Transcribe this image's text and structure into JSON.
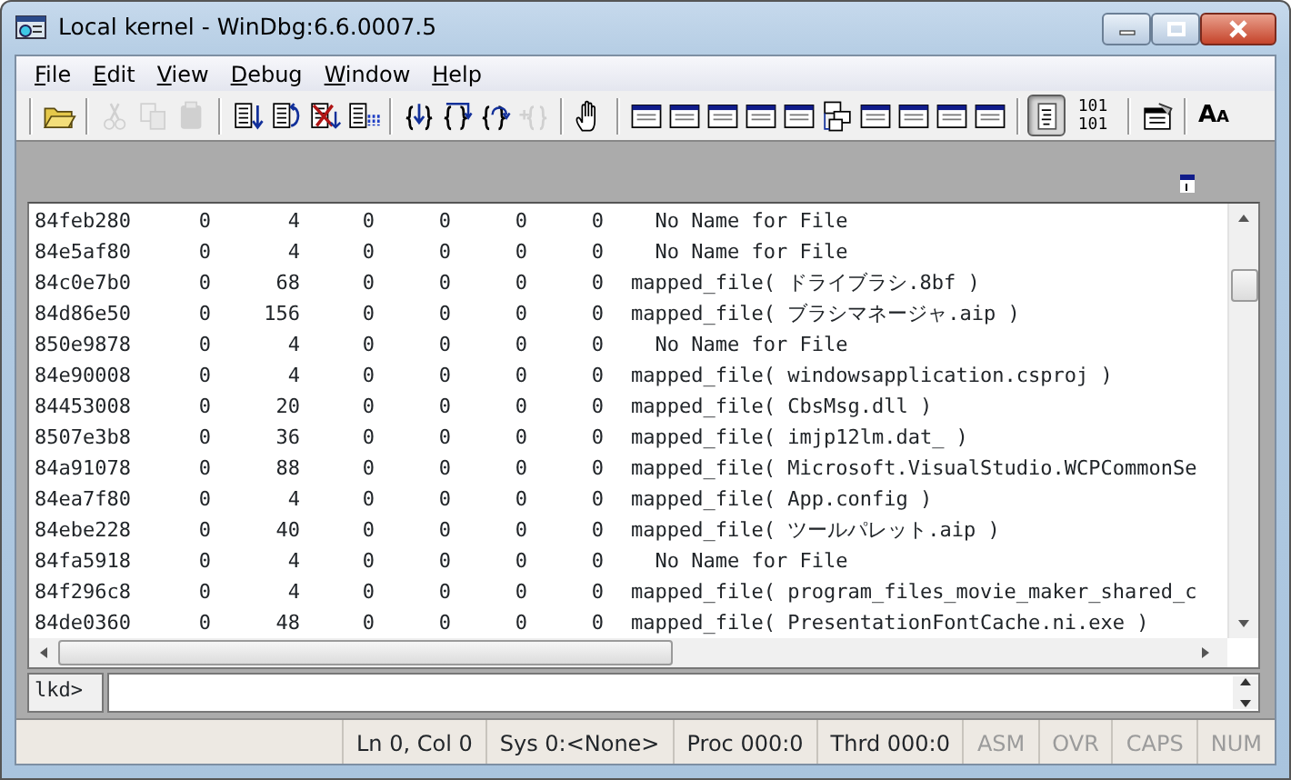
{
  "window": {
    "title": "Local kernel - WinDbg:6.6.0007.5"
  },
  "menu": [
    "File",
    "Edit",
    "View",
    "Debug",
    "Window",
    "Help"
  ],
  "toolbar": [
    {
      "kind": "sep"
    },
    {
      "kind": "open",
      "disabled": false
    },
    {
      "kind": "sep"
    },
    {
      "kind": "cut",
      "disabled": true
    },
    {
      "kind": "copy",
      "disabled": true
    },
    {
      "kind": "paste",
      "disabled": true
    },
    {
      "kind": "sep"
    },
    {
      "kind": "step-into",
      "disabled": false
    },
    {
      "kind": "step-over",
      "disabled": false
    },
    {
      "kind": "step-out",
      "disabled": false
    },
    {
      "kind": "run-to-cursor",
      "disabled": false
    },
    {
      "kind": "sep"
    },
    {
      "kind": "brace-into",
      "disabled": false
    },
    {
      "kind": "brace-over",
      "disabled": false
    },
    {
      "kind": "brace-out",
      "disabled": false
    },
    {
      "kind": "brace-back",
      "disabled": true
    },
    {
      "kind": "sep"
    },
    {
      "kind": "hand",
      "disabled": false
    },
    {
      "kind": "sep"
    },
    {
      "kind": "window",
      "disabled": false
    },
    {
      "kind": "window",
      "disabled": false
    },
    {
      "kind": "window",
      "disabled": false
    },
    {
      "kind": "window",
      "disabled": false
    },
    {
      "kind": "window",
      "disabled": false
    },
    {
      "kind": "tree",
      "disabled": false
    },
    {
      "kind": "window",
      "disabled": false
    },
    {
      "kind": "window",
      "disabled": false
    },
    {
      "kind": "window",
      "disabled": false
    },
    {
      "kind": "window",
      "disabled": false
    },
    {
      "kind": "sep"
    },
    {
      "kind": "source-mode",
      "disabled": false,
      "pressed": true
    },
    {
      "kind": "binary",
      "disabled": false,
      "lines": [
        "101",
        "101"
      ]
    },
    {
      "kind": "sep"
    },
    {
      "kind": "options",
      "disabled": false
    },
    {
      "kind": "sep"
    },
    {
      "kind": "font",
      "disabled": false,
      "glyphs": [
        "A",
        "A"
      ]
    }
  ],
  "output": {
    "rows": [
      {
        "address": "84feb280",
        "column_2": "0",
        "column_3": "4",
        "column_4": "0",
        "column_5": "0",
        "column_6": "0",
        "column_7": "0",
        "file": "  No Name for File"
      },
      {
        "address": "84e5af80",
        "column_2": "0",
        "column_3": "4",
        "column_4": "0",
        "column_5": "0",
        "column_6": "0",
        "column_7": "0",
        "file": "  No Name for File"
      },
      {
        "address": "84c0e7b0",
        "column_2": "0",
        "column_3": "68",
        "column_4": "0",
        "column_5": "0",
        "column_6": "0",
        "column_7": "0",
        "file": "mapped_file( ドライブラシ.8bf )"
      },
      {
        "address": "84d86e50",
        "column_2": "0",
        "column_3": "156",
        "column_4": "0",
        "column_5": "0",
        "column_6": "0",
        "column_7": "0",
        "file": "mapped_file( ブラシマネージャ.aip )"
      },
      {
        "address": "850e9878",
        "column_2": "0",
        "column_3": "4",
        "column_4": "0",
        "column_5": "0",
        "column_6": "0",
        "column_7": "0",
        "file": "  No Name for File"
      },
      {
        "address": "84e90008",
        "column_2": "0",
        "column_3": "4",
        "column_4": "0",
        "column_5": "0",
        "column_6": "0",
        "column_7": "0",
        "file": "mapped_file( windowsapplication.csproj )"
      },
      {
        "address": "84453008",
        "column_2": "0",
        "column_3": "20",
        "column_4": "0",
        "column_5": "0",
        "column_6": "0",
        "column_7": "0",
        "file": "mapped_file( CbsMsg.dll )"
      },
      {
        "address": "8507e3b8",
        "column_2": "0",
        "column_3": "36",
        "column_4": "0",
        "column_5": "0",
        "column_6": "0",
        "column_7": "0",
        "file": "mapped_file( imjp12lm.dat_ )"
      },
      {
        "address": "84a91078",
        "column_2": "0",
        "column_3": "88",
        "column_4": "0",
        "column_5": "0",
        "column_6": "0",
        "column_7": "0",
        "file": "mapped_file( Microsoft.VisualStudio.WCPCommonSe"
      },
      {
        "address": "84ea7f80",
        "column_2": "0",
        "column_3": "4",
        "column_4": "0",
        "column_5": "0",
        "column_6": "0",
        "column_7": "0",
        "file": "mapped_file( App.config )"
      },
      {
        "address": "84ebe228",
        "column_2": "0",
        "column_3": "40",
        "column_4": "0",
        "column_5": "0",
        "column_6": "0",
        "column_7": "0",
        "file": "mapped_file( ツールパレット.aip )"
      },
      {
        "address": "84fa5918",
        "column_2": "0",
        "column_3": "4",
        "column_4": "0",
        "column_5": "0",
        "column_6": "0",
        "column_7": "0",
        "file": "  No Name for File"
      },
      {
        "address": "84f296c8",
        "column_2": "0",
        "column_3": "4",
        "column_4": "0",
        "column_5": "0",
        "column_6": "0",
        "column_7": "0",
        "file": "mapped_file( program_files_movie_maker_shared_c"
      },
      {
        "address": "84de0360",
        "column_2": "0",
        "column_3": "48",
        "column_4": "0",
        "column_5": "0",
        "column_6": "0",
        "column_7": "0",
        "file": "mapped_file( PresentationFontCache.ni.exe )"
      }
    ]
  },
  "command": {
    "prompt": "lkd>"
  },
  "status_bar": [
    {
      "text": "Ln 0, Col 0",
      "disabled": false
    },
    {
      "text": "Sys 0:<None>",
      "disabled": false
    },
    {
      "text": "Proc 000:0",
      "disabled": false
    },
    {
      "text": "Thrd 000:0",
      "disabled": false
    },
    {
      "text": "ASM",
      "disabled": true
    },
    {
      "text": "OVR",
      "disabled": true
    },
    {
      "text": "CAPS",
      "disabled": true
    },
    {
      "text": "NUM",
      "disabled": true
    }
  ]
}
